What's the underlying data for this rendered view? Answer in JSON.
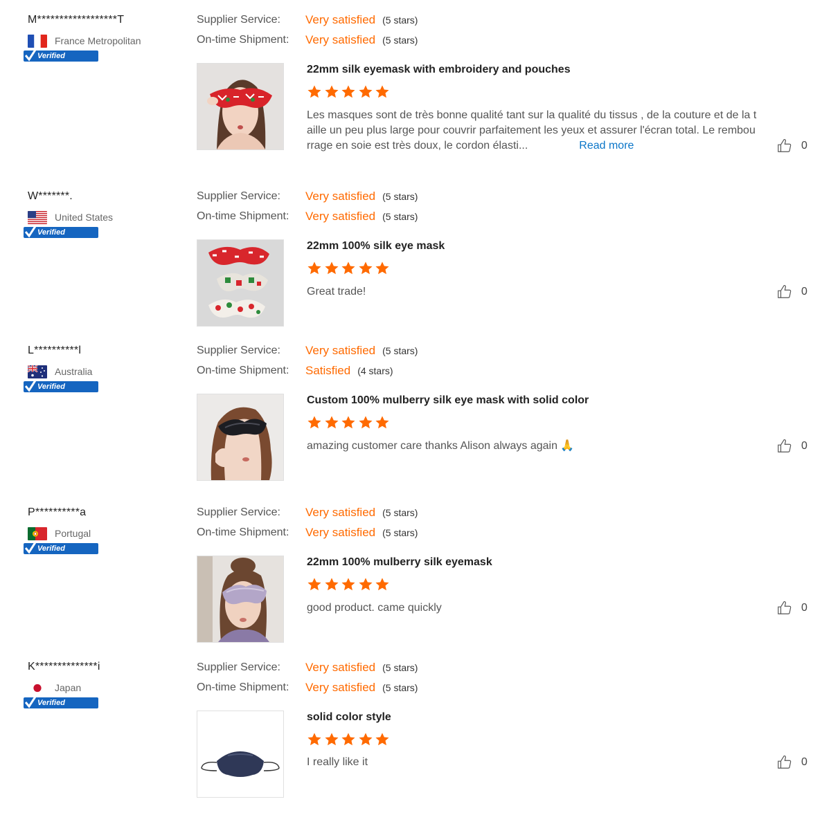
{
  "labels": {
    "supplier_service": "Supplier Service:",
    "on_time_shipment": "On-time Shipment:",
    "verified": "Verified",
    "read_more": "Read more"
  },
  "colors": {
    "accent": "#ff6a00",
    "link": "#0a75c8",
    "verified_badge": "#1565c0"
  },
  "reviews": [
    {
      "user": "M******************T",
      "country": "France Metropolitan",
      "flag_icon": "france-flag-icon",
      "supplier_service": {
        "value": "Very satisfied",
        "stars": "(5 stars)"
      },
      "on_time_shipment": {
        "value": "Very satisfied",
        "stars": "(5 stars)"
      },
      "product_image": "product-image-embroidered-eyemask",
      "product_title": "22mm silk eyemask with embroidery and pouches",
      "rating": 5,
      "comment": "Les masques sont de très bonne qualité tant sur la qualité du tissus , de la couture et de la t aille un peu plus large pour couvrir parfaitement les yeux et assurer l'écran total. Le rembou rrage en soie est très doux, le cordon élasti...",
      "helpful_count": "0"
    },
    {
      "user": "W*******.",
      "country": "United States",
      "flag_icon": "usa-flag-icon",
      "supplier_service": {
        "value": "Very satisfied",
        "stars": "(5 stars)"
      },
      "on_time_shipment": {
        "value": "Very satisfied",
        "stars": "(5 stars)"
      },
      "product_image": "product-image-printed-eye-masks",
      "product_title": "22mm 100% silk eye mask",
      "rating": 5,
      "comment": "Great trade!",
      "helpful_count": "0"
    },
    {
      "user": "L**********l",
      "country": "Australia",
      "flag_icon": "australia-flag-icon",
      "supplier_service": {
        "value": "Very satisfied",
        "stars": "(5 stars)"
      },
      "on_time_shipment": {
        "value": "Satisfied",
        "stars": "(4 stars)"
      },
      "product_image": "product-image-black-eye-mask",
      "product_title": "Custom 100% mulberry silk eye mask with solid color",
      "rating": 5,
      "comment": "amazing customer care thanks Alison always again 🙏",
      "helpful_count": "0"
    },
    {
      "user": "P**********a",
      "country": "Portugal",
      "flag_icon": "portugal-flag-icon",
      "supplier_service": {
        "value": "Very satisfied",
        "stars": "(5 stars)"
      },
      "on_time_shipment": {
        "value": "Very satisfied",
        "stars": "(5 stars)"
      },
      "product_image": "product-image-lavender-eyemask",
      "product_title": "22mm 100% mulberry silk eyemask",
      "rating": 5,
      "comment": "good product. came quickly",
      "helpful_count": "0"
    },
    {
      "user": "K**************i",
      "country": "Japan",
      "flag_icon": "japan-flag-icon",
      "supplier_service": {
        "value": "Very satisfied",
        "stars": "(5 stars)"
      },
      "on_time_shipment": {
        "value": "Very satisfied",
        "stars": "(5 stars)"
      },
      "product_image": "product-image-face-mask",
      "product_title": "solid color style",
      "rating": 5,
      "comment": "I really like it",
      "helpful_count": "0"
    }
  ]
}
